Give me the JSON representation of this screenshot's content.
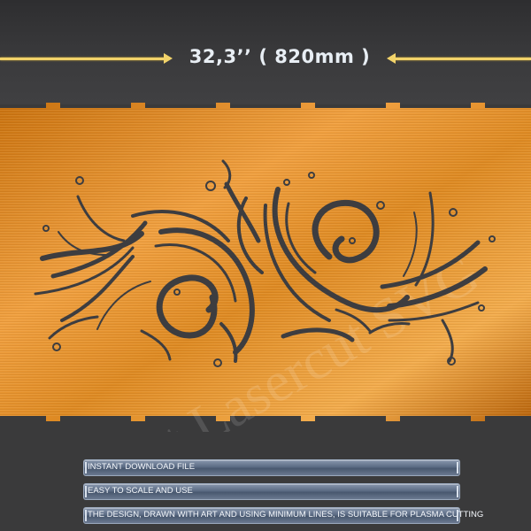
{
  "dimension": {
    "label": "32,3’’ ( 820mm )"
  },
  "panel": {
    "material_color": "#e08a1f",
    "highlight_color": "#f2a63a",
    "shadow_color": "#a9580d",
    "cutout_color": "#3d3d40"
  },
  "watermark": {
    "text": "Cut Lasercut SVG"
  },
  "features": [
    {
      "label": "INSTANT DOWNLOAD FILE"
    },
    {
      "label": "EASY TO SCALE AND USE"
    },
    {
      "label": "THE DESIGN, DRAWN WITH ART AND USING MINIMUM LINES, IS SUITABLE FOR PLASMA CUTTING"
    }
  ]
}
